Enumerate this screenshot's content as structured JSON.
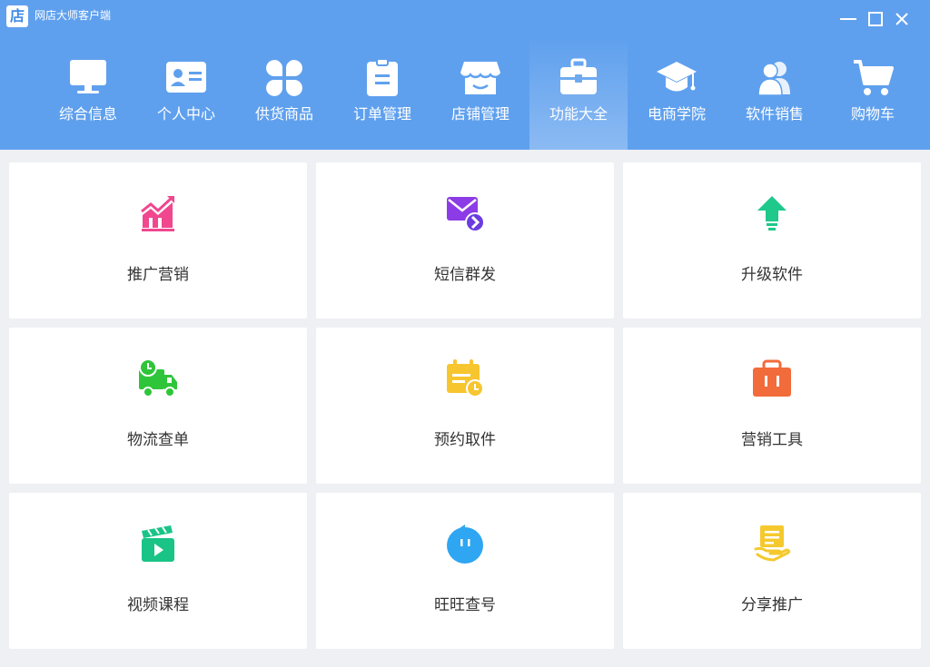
{
  "window": {
    "logo_glyph": "店",
    "title": "网店大师客户端",
    "controls": [
      "minimize-icon",
      "maximize-icon",
      "close-icon"
    ]
  },
  "colors": {
    "header_bg": "#5fa0ee",
    "body_bg": "#eef0f3",
    "card_bg": "#ffffff"
  },
  "nav": {
    "active_index": 5,
    "items": [
      {
        "label": "综合信息",
        "icon": "monitor-icon"
      },
      {
        "label": "个人中心",
        "icon": "id-card-icon"
      },
      {
        "label": "供货商品",
        "icon": "four-leaf-icon"
      },
      {
        "label": "订单管理",
        "icon": "clipboard-icon"
      },
      {
        "label": "店铺管理",
        "icon": "storefront-icon"
      },
      {
        "label": "功能大全",
        "icon": "toolbox-icon"
      },
      {
        "label": "电商学院",
        "icon": "graduation-cap-icon"
      },
      {
        "label": "软件销售",
        "icon": "users-icon"
      },
      {
        "label": "购物车",
        "icon": "cart-icon"
      }
    ]
  },
  "features": [
    {
      "label": "推广营销",
      "icon": "chart-growth-icon",
      "color": "#f0478f"
    },
    {
      "label": "短信群发",
      "icon": "mail-send-icon",
      "color": "#8c3ce6"
    },
    {
      "label": "升级软件",
      "icon": "arrow-up-icon",
      "color": "#1fc98b"
    },
    {
      "label": "物流查单",
      "icon": "delivery-truck-icon",
      "color": "#2fc53a"
    },
    {
      "label": "预约取件",
      "icon": "calendar-clock-icon",
      "color": "#f7c52e"
    },
    {
      "label": "营销工具",
      "icon": "briefcase-icon",
      "color": "#f26b3a"
    },
    {
      "label": "视频课程",
      "icon": "video-clapper-icon",
      "color": "#19c486"
    },
    {
      "label": "旺旺查号",
      "icon": "chat-bubble-icon",
      "color": "#2ea6f2"
    },
    {
      "label": "分享推广",
      "icon": "share-hand-icon",
      "color": "#f5c92e"
    }
  ]
}
